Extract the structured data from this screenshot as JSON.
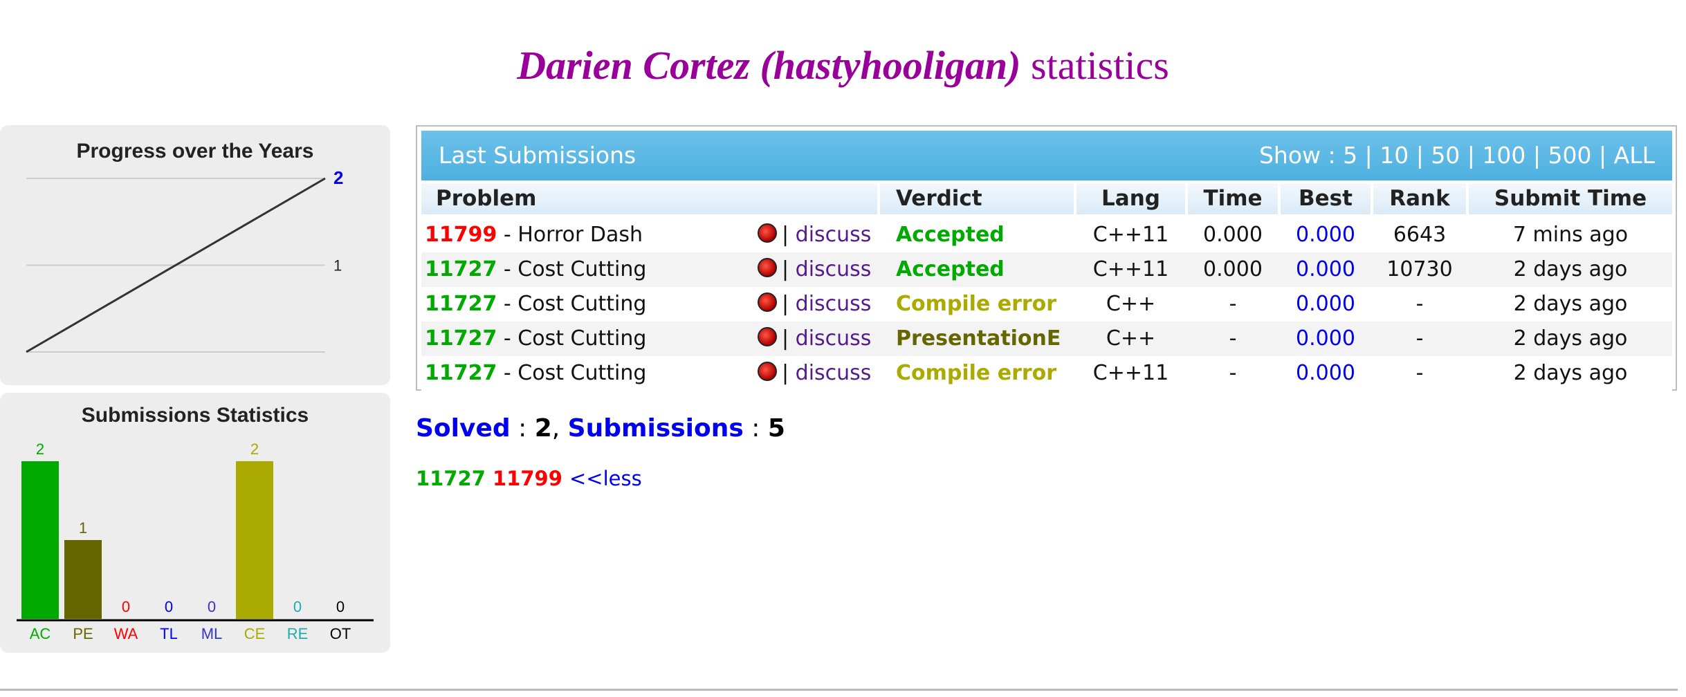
{
  "page": {
    "title_name": "Darien Cortez (hastyhooligan)",
    "title_suffix": "statistics"
  },
  "progress_chart": {
    "title": "Progress over the Years",
    "values": [
      0,
      2
    ],
    "ylim": [
      0,
      2
    ],
    "tick_labels": [
      "1",
      "2"
    ],
    "line_color": "#333333",
    "max_label_color": "#0000ee"
  },
  "chart_data": {
    "type": "bar",
    "title": "Submissions Statistics",
    "categories": [
      "AC",
      "PE",
      "WA",
      "TL",
      "ML",
      "CE",
      "RE",
      "OT"
    ],
    "values": [
      2,
      1,
      0,
      0,
      0,
      2,
      0,
      0
    ],
    "ylim": [
      0,
      2
    ],
    "colors": [
      "#00aa00",
      "#666600",
      "#ff0000",
      "#0000ff",
      "#3333cc",
      "#aaaa00",
      "#22aaaa",
      "#000000"
    ]
  },
  "submissions": {
    "header_title": "Last Submissions",
    "show_label": "Show :",
    "show_options": [
      "5",
      "10",
      "50",
      "100",
      "500",
      "ALL"
    ],
    "columns": [
      "Problem",
      "Verdict",
      "Lang",
      "Time",
      "Best",
      "Rank",
      "Submit Time"
    ],
    "discuss_label": "discuss",
    "separator": "|",
    "rows": [
      {
        "id": "11799",
        "id_color": "#ff0000",
        "name": "- Horror Dash",
        "verdict": "Accepted",
        "verdict_color": "#00aa00",
        "lang": "C++11",
        "time": "0.000",
        "best": "0.000",
        "rank": "6643",
        "submit": "7 mins ago"
      },
      {
        "id": "11727",
        "id_color": "#00aa00",
        "name": "- Cost Cutting",
        "verdict": "Accepted",
        "verdict_color": "#00aa00",
        "lang": "C++11",
        "time": "0.000",
        "best": "0.000",
        "rank": "10730",
        "submit": "2 days ago"
      },
      {
        "id": "11727",
        "id_color": "#00aa00",
        "name": "- Cost Cutting",
        "verdict": "Compile error",
        "verdict_color": "#aaaa00",
        "lang": "C++",
        "time": "-",
        "best": "0.000",
        "rank": "-",
        "submit": "2 days ago"
      },
      {
        "id": "11727",
        "id_color": "#00aa00",
        "name": "- Cost Cutting",
        "verdict": "PresentationE",
        "verdict_color": "#666600",
        "lang": "C++",
        "time": "-",
        "best": "0.000",
        "rank": "-",
        "submit": "2 days ago"
      },
      {
        "id": "11727",
        "id_color": "#00aa00",
        "name": "- Cost Cutting",
        "verdict": "Compile error",
        "verdict_color": "#aaaa00",
        "lang": "C++11",
        "time": "-",
        "best": "0.000",
        "rank": "-",
        "submit": "2 days ago"
      }
    ]
  },
  "summary": {
    "solved_label": "Solved",
    "solved_count": "2",
    "submissions_label": "Submissions",
    "submissions_count": "5"
  },
  "solved_list": {
    "problems": [
      {
        "id": "11727",
        "color": "#00aa00"
      },
      {
        "id": "11799",
        "color": "#ff0000"
      }
    ],
    "less_label": "<<less"
  },
  "colors": {
    "title": "#990099",
    "header_blue": "#4eb0e0",
    "link_blue": "#0000ee",
    "best_blue": "#0000ee"
  }
}
